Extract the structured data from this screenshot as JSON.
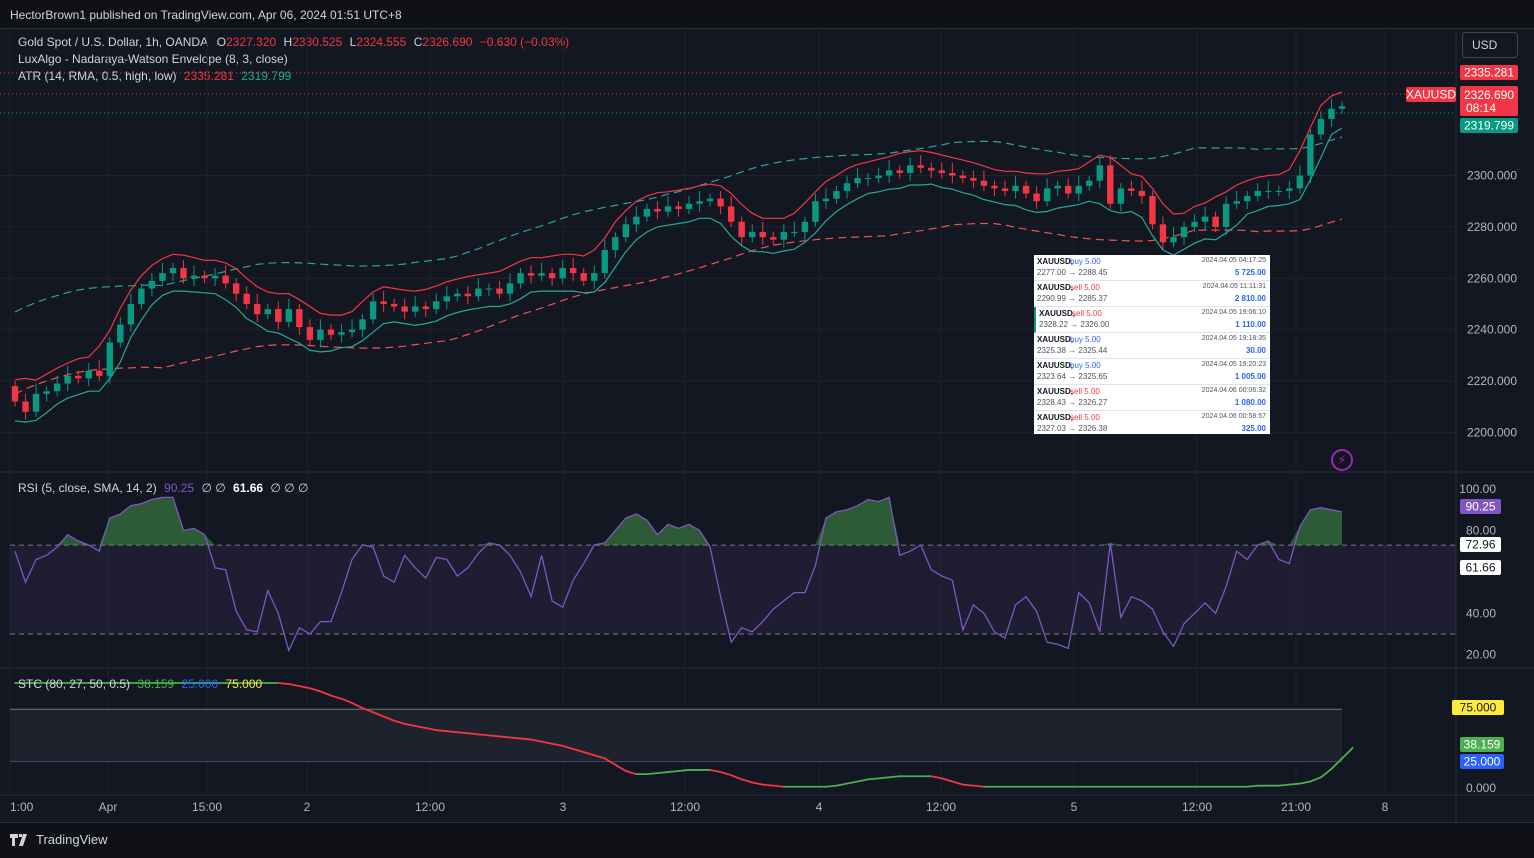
{
  "header": {
    "published": "HectorBrown1 published on TradingView.com, Apr 06, 2024 01:51 UTC+8"
  },
  "footer": {
    "brand": "TradingView"
  },
  "currency_button": "USD",
  "legend": {
    "main": {
      "symbol": "Gold Spot / U.S. Dollar, 1h, OANDA",
      "o_label": "O",
      "o": "2327.320",
      "h_label": "H",
      "h": "2330.525",
      "l_label": "L",
      "l": "2324.555",
      "c_label": "C",
      "c": "2326.690",
      "change": "−0.630 (−0.03%)"
    },
    "envelope": "LuxAlgo - Nadaraya-Watson Envelope (8, 3, close)",
    "atr": {
      "label": "ATR (14, RMA, 0.5, high, low)",
      "upper": "2335.281",
      "lower": "2319.799"
    },
    "rsi": {
      "label": "RSI (5, close, SMA, 14, 2)",
      "v1": "90.25",
      "blank": "∅ ∅",
      "v2": "61.66",
      "blank2": "∅ ∅ ∅"
    },
    "stc": {
      "label": "STC (80, 27, 50, 0.5)",
      "v1": "38.159",
      "v2": "25.000",
      "v3": "75.000"
    }
  },
  "colors": {
    "up": "#089981",
    "down": "#f23645",
    "rsi_line": "#7e57c2",
    "stc_up": "#4caf50",
    "stc_down": "#f23645",
    "bg": "#131722"
  },
  "price_labels": {
    "upper": "2335.281",
    "close": "2326.690",
    "countdown": "08:14",
    "lower": "2319.799",
    "symbol": "XAUUSD"
  },
  "rsi_labels": {
    "value": "90.25",
    "upper_band": "72.96",
    "ma": "61.66"
  },
  "stc_labels": {
    "upper": "75.000",
    "value": "38.159",
    "lower": "25.000"
  },
  "trades": [
    {
      "sym": "XAUUSD,",
      "side": "buy 5.00",
      "time": "2024.04.05 04:17:25",
      "prices": "2277.00 → 2288.45",
      "profit": "5 725.00"
    },
    {
      "sym": "XAUUSD,",
      "side": "sell 5.00",
      "time": "2024.04.05 11:11:31",
      "prices": "2290.99 → 2285.37",
      "profit": "2 810.00"
    },
    {
      "sym": "XAUUSD,",
      "side": "sell 5.00",
      "time": "2024.04.05 19:06:10",
      "prices": "2328.22 → 2326.00",
      "profit": "1 110.00"
    },
    {
      "sym": "XAUUSD,",
      "side": "buy 5.00",
      "time": "2024.04.05 19:18:35",
      "prices": "2325.38 → 2325.44",
      "profit": "30.00"
    },
    {
      "sym": "XAUUSD,",
      "side": "buy 5.00",
      "time": "2024.04.05 19:20:23",
      "prices": "2323.64 → 2325.65",
      "profit": "1 005.00"
    },
    {
      "sym": "XAUUSD,",
      "side": "sell 5.00",
      "time": "2024.04.06 00:06:32",
      "prices": "2328.43 → 2326.27",
      "profit": "1 080.00"
    },
    {
      "sym": "XAUUSD,",
      "side": "sell 5.00",
      "time": "2024.04.06 00:58:57",
      "prices": "2327.03 → 2326.38",
      "profit": "325.00"
    }
  ],
  "chart_data": [
    {
      "type": "candlestick",
      "title": "Gold Spot / U.S. Dollar, 1h, OANDA",
      "ylim": [
        2190,
        2345
      ],
      "y_ticks": [
        "2200.000",
        "2220.000",
        "2240.000",
        "2260.000",
        "2280.000",
        "2300.000"
      ],
      "x_ticks": [
        "1:00",
        "Apr",
        "15:00",
        "2",
        "12:00",
        "3",
        "12:00",
        "4",
        "12:00",
        "5",
        "12:00",
        "21:00",
        "8"
      ],
      "closes": [
        2212,
        2208,
        2215,
        2216,
        2219,
        2222,
        2221,
        2224,
        2222,
        2235,
        2242,
        2250,
        2256,
        2259,
        2262,
        2264,
        2260,
        2261,
        2260,
        2261,
        2258,
        2254,
        2250,
        2246,
        2248,
        2243,
        2248,
        2241,
        2236,
        2240,
        2238,
        2239,
        2240,
        2244,
        2251,
        2250,
        2249,
        2247,
        2249,
        2248,
        2251,
        2253,
        2254,
        2253,
        2256,
        2256,
        2254,
        2258,
        2262,
        2261,
        2262,
        2260,
        2264,
        2262,
        2259,
        2262,
        2271,
        2276,
        2281,
        2284,
        2287,
        2286,
        2288,
        2287,
        2289,
        2290,
        2291,
        2288,
        2282,
        2276,
        2278,
        2276,
        2275,
        2278,
        2278,
        2282,
        2290,
        2291,
        2294,
        2297,
        2299,
        2299,
        2300,
        2302,
        2301,
        2304,
        2303,
        2302,
        2301,
        2300,
        2299,
        2298,
        2296,
        2295,
        2294,
        2296,
        2293,
        2290,
        2295,
        2296,
        2293,
        2296,
        2298,
        2304,
        2289,
        2295,
        2294,
        2292,
        2281,
        2274,
        2276,
        2280,
        2282,
        2284,
        2280,
        2289,
        2290,
        2292,
        2294,
        2294,
        2294,
        2295,
        2300,
        2316,
        2322,
        2326,
        2327
      ]
    },
    {
      "type": "line",
      "title": "RSI (5, close, SMA, 14, 2)",
      "ylim": [
        15,
        102
      ],
      "y_ticks": [
        "20.00",
        "40.00",
        "80.00",
        "100.00"
      ],
      "bands": [
        72.96,
        30
      ],
      "values": [
        70,
        55,
        66,
        68,
        72,
        78,
        75,
        73,
        70,
        86,
        88,
        92,
        93,
        95,
        96,
        96,
        80,
        81,
        78,
        62,
        61,
        41,
        32,
        31,
        51,
        40,
        22,
        33,
        30,
        36,
        36,
        50,
        66,
        73,
        72,
        58,
        55,
        68,
        62,
        57,
        67,
        66,
        58,
        62,
        69,
        74,
        73,
        68,
        60,
        48,
        68,
        46,
        43,
        56,
        64,
        73,
        74,
        80,
        86,
        88,
        85,
        78,
        83,
        81,
        83,
        80,
        72,
        48,
        26,
        33,
        31,
        36,
        42,
        46,
        50,
        50,
        63,
        86,
        89,
        90,
        92,
        95,
        94,
        96,
        68,
        70,
        73,
        61,
        58,
        56,
        32,
        44,
        40,
        31,
        28,
        44,
        48,
        41,
        26,
        25,
        23,
        50,
        45,
        31,
        74,
        38,
        48,
        46,
        42,
        31,
        24,
        35,
        40,
        45,
        40,
        53,
        70,
        66,
        73,
        75,
        66,
        64,
        82,
        90,
        91,
        90,
        89
      ],
      "ma": 61.66
    },
    {
      "type": "line",
      "title": "STC (80, 27, 50, 0.5)",
      "ylim": [
        -5,
        100
      ],
      "y_ticks": [
        "0.000",
        "25.000",
        "75.000"
      ],
      "levels": [
        75,
        25
      ],
      "values": [
        100,
        100,
        100,
        100,
        100,
        100,
        100,
        100,
        100,
        100,
        100,
        100,
        100,
        100,
        100,
        100,
        100,
        100,
        100,
        100,
        100,
        100,
        100,
        100,
        100,
        100,
        99,
        97,
        95,
        92,
        88,
        85,
        81,
        76,
        72,
        68,
        64,
        61,
        59,
        57,
        55,
        54,
        53,
        52,
        51,
        50,
        49,
        48,
        47,
        46,
        44,
        42,
        40,
        37,
        34,
        31,
        28,
        22,
        16,
        13,
        13,
        14,
        15,
        16,
        17,
        17,
        17,
        15,
        12,
        8,
        5,
        3,
        2,
        1,
        1,
        1,
        1,
        1,
        2,
        4,
        6,
        8,
        9,
        10,
        11,
        11,
        11,
        11,
        9,
        6,
        3,
        2,
        1,
        1,
        1,
        1,
        1,
        1,
        1,
        1,
        1,
        1,
        1,
        1,
        1,
        1,
        1,
        1,
        1,
        1,
        1,
        1,
        1,
        1,
        1,
        1,
        1,
        1,
        2,
        2,
        2,
        3,
        4,
        6,
        10,
        18,
        28,
        38
      ]
    }
  ]
}
